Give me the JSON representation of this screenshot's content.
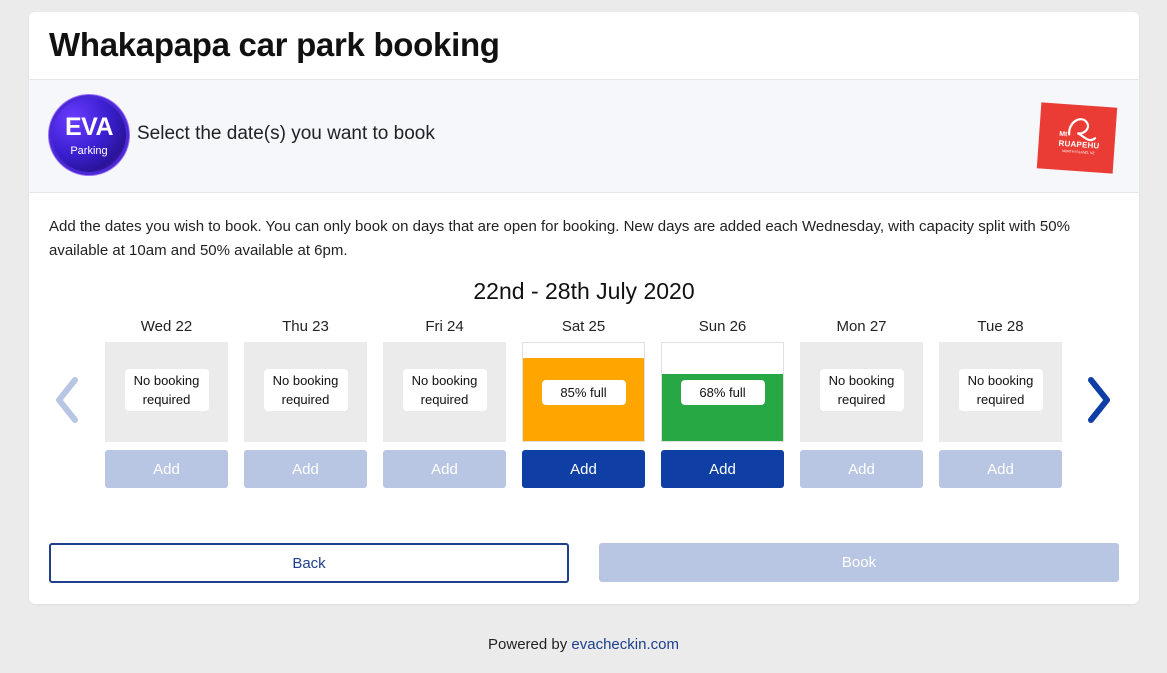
{
  "page": {
    "title": "Whakapapa car park booking"
  },
  "banner": {
    "text": "Select the date(s) you want to book",
    "eva_logo": {
      "word": "EVA",
      "sub": "Parking"
    },
    "mt_logo": {
      "top": "Mt",
      "name": "RUAPEHU",
      "region": "NORTH ISLAND, NZ"
    }
  },
  "intro": "Add the dates you wish to book. You can only book on days that are open for booking. New days are added each Wednesday, with capacity split with 50% available at 10am and 50% available at 6pm.",
  "week": {
    "title": "22nd - 28th July 2020",
    "prev_icon": "chevron-left-icon",
    "next_icon": "chevron-right-icon",
    "days": [
      {
        "label": "Wed 22",
        "status": "No booking required",
        "fill_percent": null,
        "fill_color": null,
        "add_label": "Add",
        "add_enabled": false
      },
      {
        "label": "Thu 23",
        "status": "No booking required",
        "fill_percent": null,
        "fill_color": null,
        "add_label": "Add",
        "add_enabled": false
      },
      {
        "label": "Fri 24",
        "status": "No booking required",
        "fill_percent": null,
        "fill_color": null,
        "add_label": "Add",
        "add_enabled": false
      },
      {
        "label": "Sat 25",
        "status": "85% full",
        "fill_percent": 85,
        "fill_color": "#ffa500",
        "add_label": "Add",
        "add_enabled": true
      },
      {
        "label": "Sun 26",
        "status": "68% full",
        "fill_percent": 68,
        "fill_color": "#28a745",
        "add_label": "Add",
        "add_enabled": true
      },
      {
        "label": "Mon 27",
        "status": "No booking required",
        "fill_percent": null,
        "fill_color": null,
        "add_label": "Add",
        "add_enabled": false
      },
      {
        "label": "Tue 28",
        "status": "No booking required",
        "fill_percent": null,
        "fill_color": null,
        "add_label": "Add",
        "add_enabled": false
      }
    ]
  },
  "actions": {
    "back_label": "Back",
    "book_label": "Book",
    "book_enabled": false
  },
  "footer": {
    "prefix": "Powered by ",
    "link_text": "evacheckin.com"
  },
  "colors": {
    "primary": "#0f3fa5",
    "disabled": "#b8c6e3",
    "arrow_disabled": "#b8c6e3",
    "arrow_active": "#0f3fa5",
    "brand_red": "#ea3b35"
  }
}
